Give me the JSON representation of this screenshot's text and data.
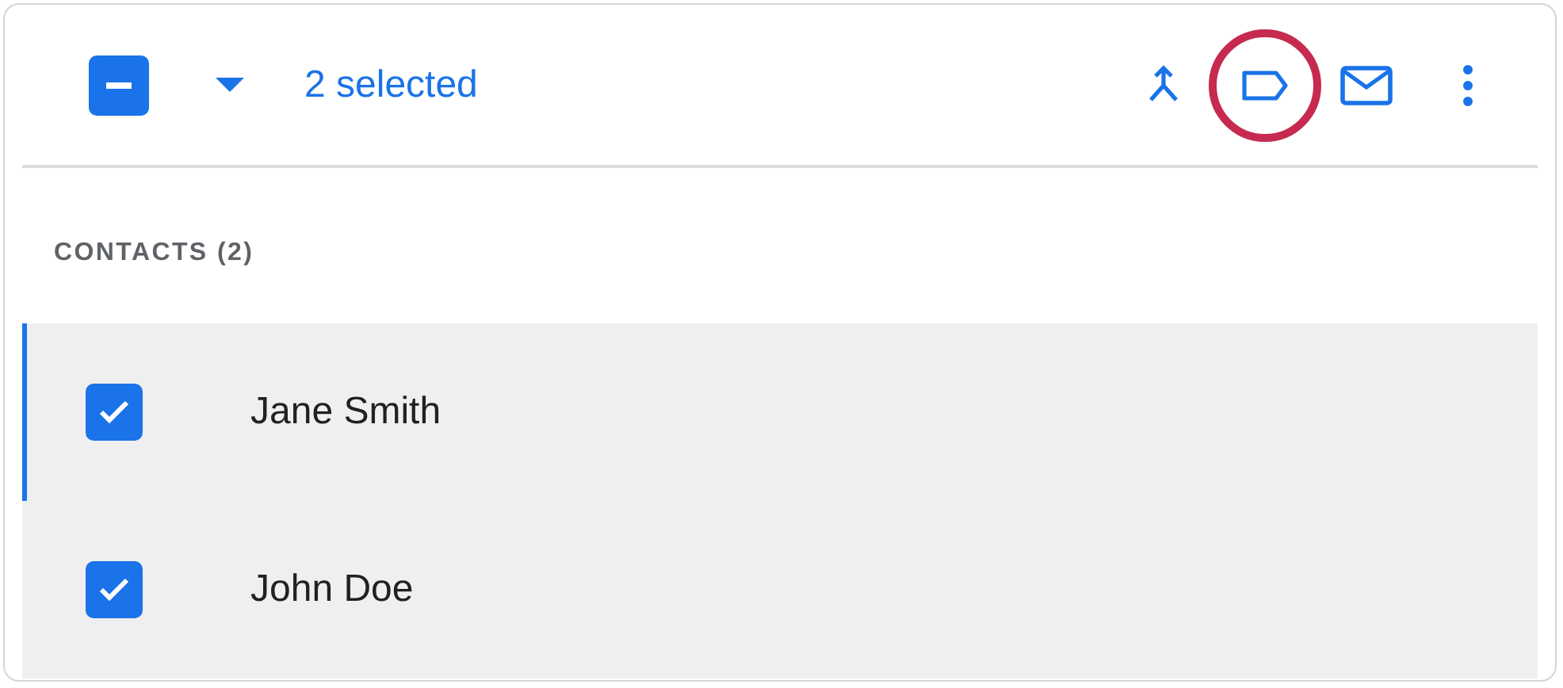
{
  "toolbar": {
    "select_all": {
      "indeterminate": true
    },
    "selection_count": "2 selected",
    "actions": [
      {
        "kind": "merge",
        "highlighted": false
      },
      {
        "kind": "label",
        "highlighted": true
      },
      {
        "kind": "email",
        "highlighted": false
      },
      {
        "kind": "more",
        "highlighted": false
      }
    ]
  },
  "section": {
    "title": "CONTACTS (2)"
  },
  "contacts": [
    {
      "name": "Jane Smith",
      "checked": true,
      "focused": true
    },
    {
      "name": "John Doe",
      "checked": true,
      "focused": false
    }
  ]
}
